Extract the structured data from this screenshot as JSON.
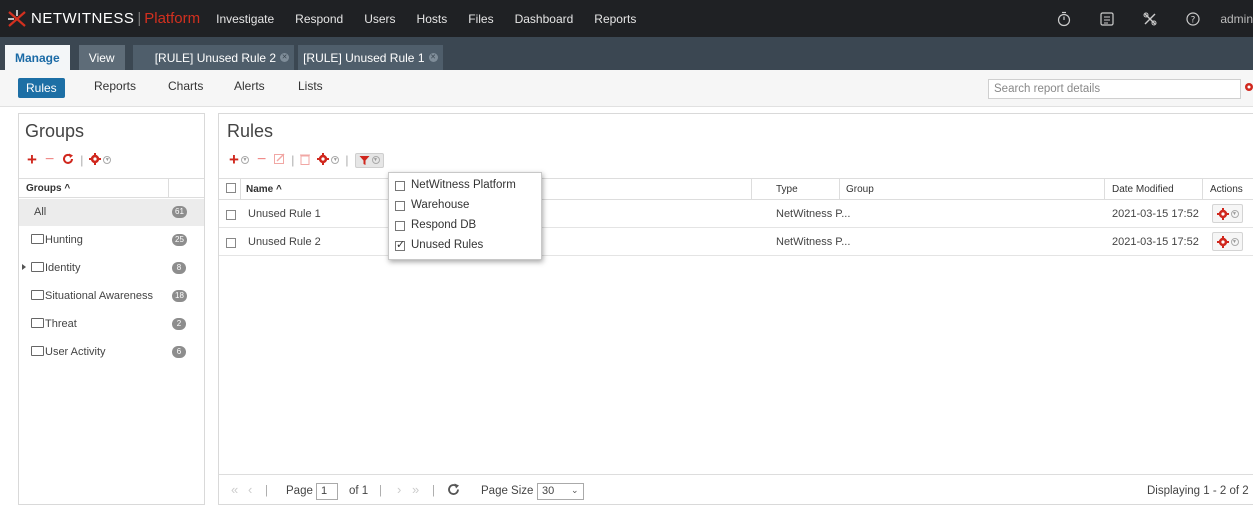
{
  "brand": {
    "name": "NETWITNESS",
    "separator": "|",
    "platform": "Platform"
  },
  "nav": {
    "items": [
      "Investigate",
      "Respond",
      "Users",
      "Hosts",
      "Files",
      "Dashboard",
      "Reports"
    ],
    "user": "admin",
    "right_icons": [
      "timer-icon",
      "console-icon",
      "tools-icon",
      "help-icon"
    ]
  },
  "module_tabs": {
    "manage": "Manage",
    "view": "View",
    "open": [
      "[RULE] Unused Rule 2",
      "[RULE] Unused Rule 1"
    ]
  },
  "subtabs": [
    "Rules",
    "Reports",
    "Charts",
    "Alerts",
    "Lists"
  ],
  "search": {
    "placeholder": "Search report details"
  },
  "groups_panel": {
    "title": "Groups",
    "header": "Groups ^",
    "items": [
      {
        "label": "All",
        "count": "61"
      },
      {
        "label": "Hunting",
        "count": "25"
      },
      {
        "label": "Identity",
        "count": "8"
      },
      {
        "label": "Situational Awareness",
        "count": "18"
      },
      {
        "label": "Threat",
        "count": "2"
      },
      {
        "label": "User Activity",
        "count": "6"
      }
    ]
  },
  "rules_panel": {
    "title": "Rules",
    "columns": {
      "name": "Name ^",
      "type": "Type",
      "group": "Group",
      "date_modified": "Date Modified",
      "actions": "Actions"
    },
    "rows": [
      {
        "name": "Unused Rule 1",
        "type": "NetWitness P...",
        "group": "",
        "date_modified": "2021-03-15 17:52"
      },
      {
        "name": "Unused Rule 2",
        "type": "NetWitness P...",
        "group": "",
        "date_modified": "2021-03-15 17:52"
      }
    ]
  },
  "filter_menu": {
    "items": [
      {
        "label": "NetWitness Platform",
        "checked": false
      },
      {
        "label": "Warehouse",
        "checked": false
      },
      {
        "label": "Respond DB",
        "checked": false
      },
      {
        "label": "Unused Rules",
        "checked": true
      }
    ]
  },
  "pager": {
    "page_label": "Page",
    "page_value": "1",
    "of_label": "of 1",
    "page_size_label": "Page Size",
    "page_size_value": "30",
    "displaying": "Displaying 1 - 2 of 2"
  },
  "colors": {
    "topnav_bg": "#1f2124",
    "brand_red": "#d2301f",
    "active_blue": "#1d6fa5",
    "tabbar_bg": "#3b4752"
  }
}
